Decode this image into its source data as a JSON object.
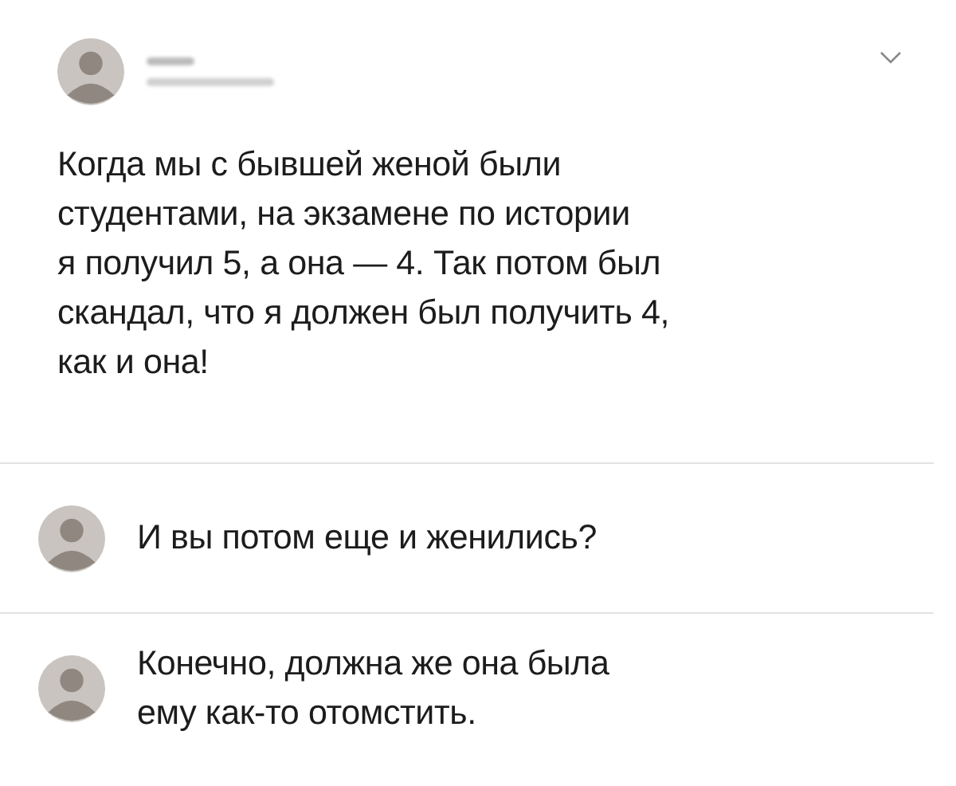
{
  "post": {
    "text_lines": [
      "Когда мы с бывшей женой были",
      "студентами, на экзамене по истории",
      "я получил 5, а она — 4. Так потом был",
      "скандал, что я должен был получить 4,",
      "как и она!"
    ]
  },
  "replies": [
    {
      "text_lines": [
        "И вы потом еще и женились?"
      ]
    },
    {
      "text_lines": [
        "Конечно, должна же она была",
        "ему как-то отомстить."
      ]
    }
  ]
}
